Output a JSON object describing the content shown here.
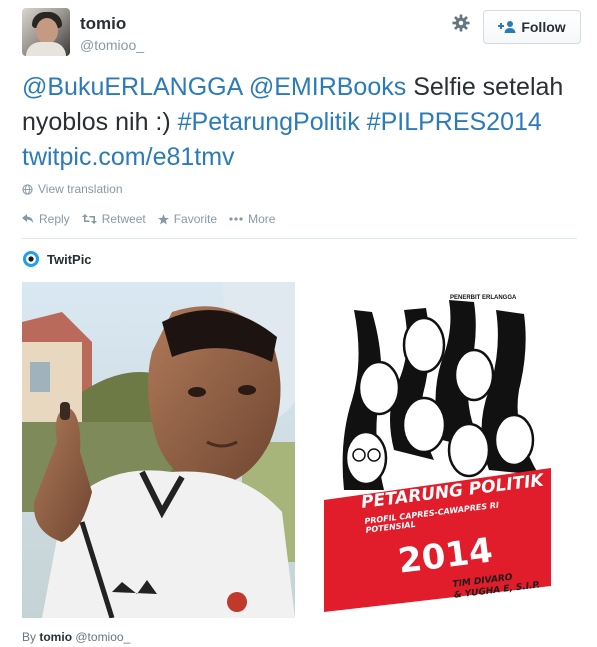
{
  "user": {
    "name": "tomio",
    "handle": "@tomioo_",
    "follow_label": "Follow"
  },
  "tweet": {
    "mention1": "@BukuERLANGGA",
    "mention2": "@EMIRBooks",
    "text1": "Selfie setelah nyoblos nih :)",
    "hashtag1": "#PetarungPolitik",
    "hashtag2": "#PILPRES2014",
    "link": "twitpic.com/e81tmv"
  },
  "translate_label": "View translation",
  "actions": {
    "reply": "Reply",
    "retweet": "Retweet",
    "favorite": "Favorite",
    "more": "More"
  },
  "card": {
    "provider": "TwitPic"
  },
  "book": {
    "publisher": "PENERBIT ERLANGGA",
    "title": "PETARUNG POLITIK",
    "subtitle": "PROFIL CAPRES-CAWAPRES RI POTENSIAL",
    "year": "2014",
    "author1": "TIM DIVARO",
    "author2": "& YUGHA E, S.I.P."
  },
  "byline": {
    "prefix": "By",
    "name": "tomio",
    "handle": "@tomioo_"
  },
  "colors": {
    "link": "#2b7bb9",
    "muted": "#8899a6",
    "banner_red": "#e11d2b",
    "twitpic_blue": "#1da1f2"
  }
}
